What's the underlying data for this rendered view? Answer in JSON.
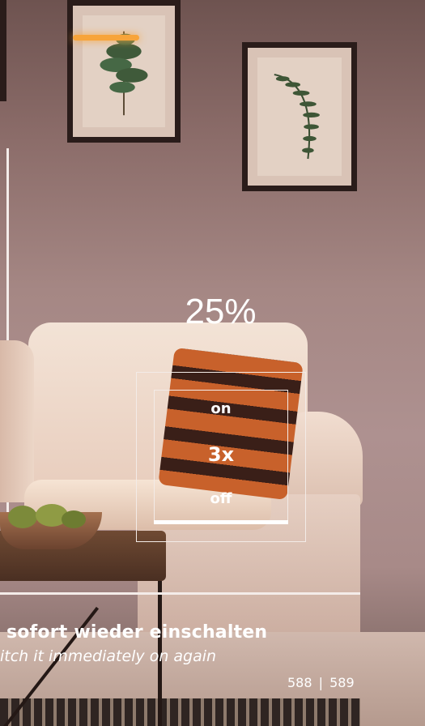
{
  "dimmer": {
    "level": "25%",
    "on_label": "on",
    "count_label": "3x",
    "off_label": "off"
  },
  "caption": {
    "german": "sofort wieder einschalten",
    "english": "itch it immediately on again"
  },
  "page_numbers": {
    "left": "588",
    "separator": "|",
    "right": "589"
  },
  "colors": {
    "wall": "#ae9190",
    "frame": "#2a1c1a",
    "overlay": "#ffffff",
    "pillow_orange": "#c8612b"
  }
}
